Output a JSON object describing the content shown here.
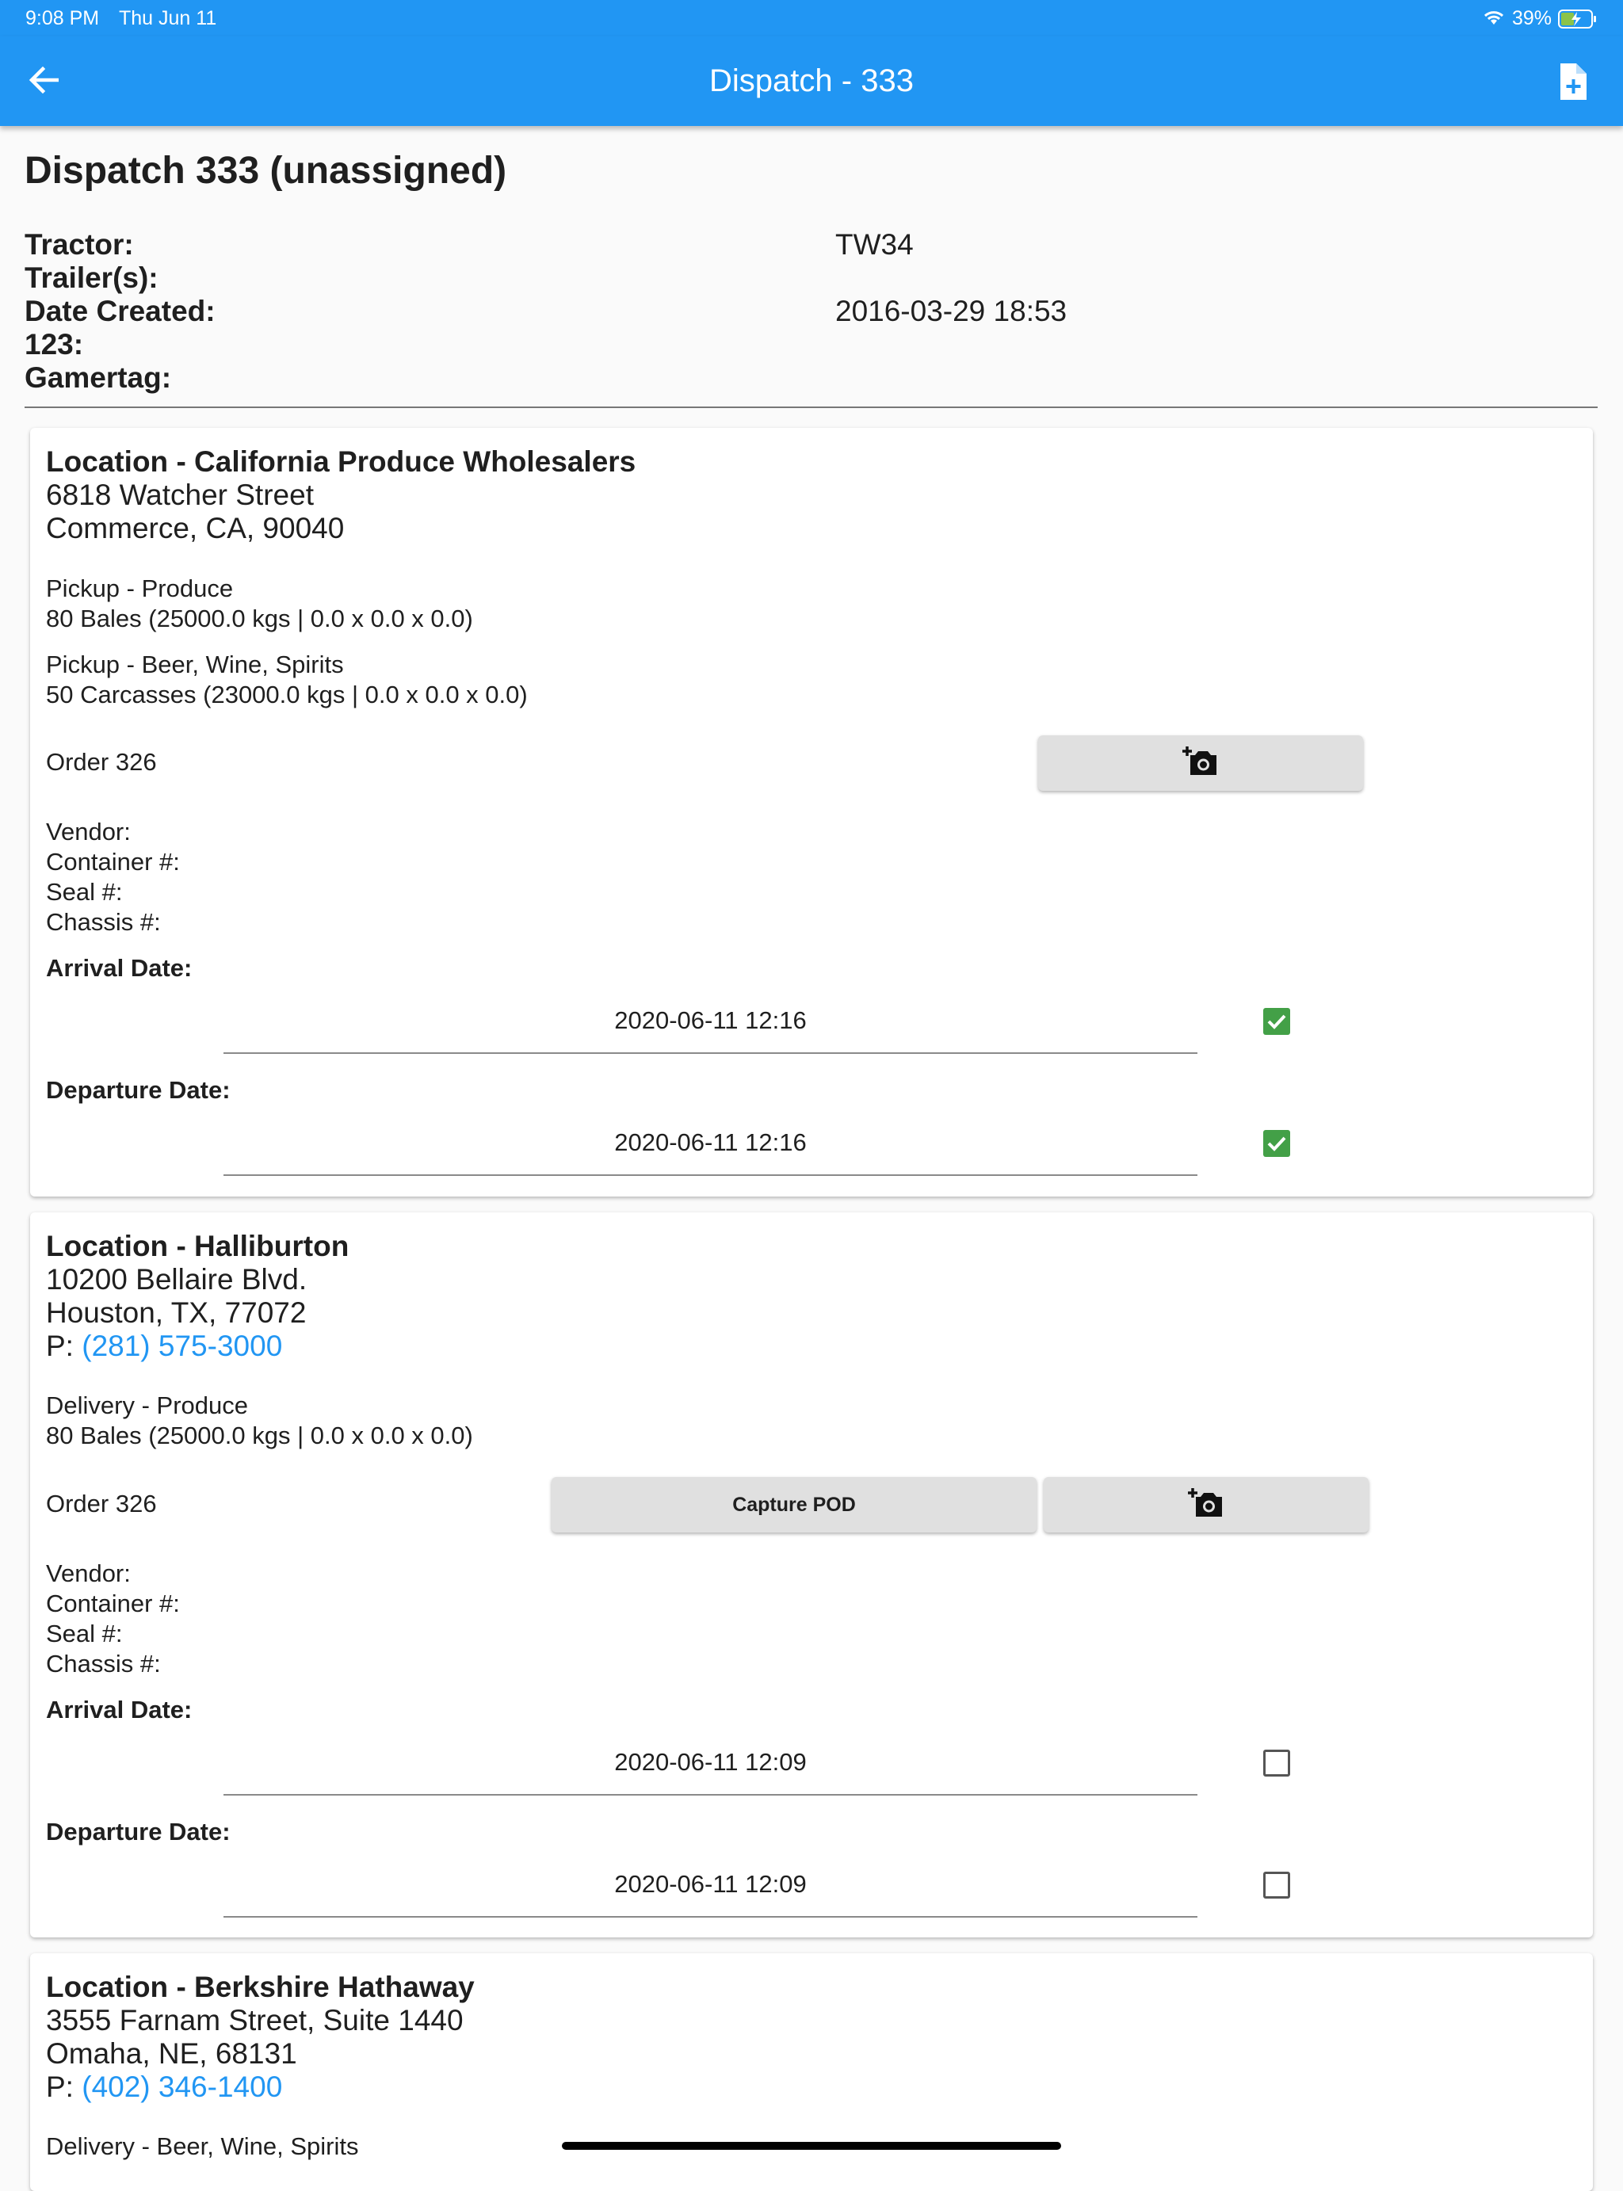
{
  "status": {
    "time": "9:08 PM",
    "date": "Thu Jun 11",
    "battery": "39%"
  },
  "appbar": {
    "title": "Dispatch - 333",
    "back_icon": "arrow-back-icon",
    "action_icon": "add-document-icon"
  },
  "dispatch": {
    "title": "Dispatch 333 (unassigned)",
    "labels": {
      "tractor": "Tractor:",
      "trailers": "Trailer(s):",
      "date_created": "Date Created:",
      "field_123": "123:",
      "gamertag": "Gamertag:"
    },
    "values": {
      "tractor": "TW34",
      "date_created": "2016-03-29 18:53"
    }
  },
  "stops": [
    {
      "title": "Location - California Produce Wholesalers",
      "address1": "6818 Watcher Street",
      "address2": "Commerce, CA, 90040",
      "items": [
        {
          "line1": "Pickup - Produce",
          "line2": "80 Bales (25000.0 kgs | 0.0 x 0.0 x 0.0)"
        },
        {
          "line1": "Pickup - Beer, Wine, Spirits",
          "line2": "50 Carcasses (23000.0 kgs | 0.0 x 0.0 x 0.0)"
        }
      ],
      "order": "Order 326",
      "vendor": "Vendor:",
      "container": "Container #:",
      "seal": "Seal #:",
      "chassis": "Chassis #:",
      "arrival_label": "Arrival Date:",
      "arrival": "2020-06-11 12:16",
      "arrival_checked": true,
      "departure_label": "Departure Date:",
      "departure": "2020-06-11 12:16",
      "departure_checked": true
    },
    {
      "title": "Location - Halliburton",
      "address1": "10200 Bellaire Blvd.",
      "address2": "Houston, TX, 77072",
      "phone_prefix": "P: ",
      "phone": "(281) 575-3000",
      "items": [
        {
          "line1": "Delivery - Produce",
          "line2": "80 Bales (25000.0 kgs | 0.0 x 0.0 x 0.0)"
        }
      ],
      "order": "Order 326",
      "pod_button": "Capture POD",
      "vendor": "Vendor:",
      "container": "Container #:",
      "seal": "Seal #:",
      "chassis": "Chassis #:",
      "arrival_label": "Arrival Date:",
      "arrival": "2020-06-11 12:09",
      "arrival_checked": false,
      "departure_label": "Departure Date:",
      "departure": "2020-06-11 12:09",
      "departure_checked": false
    },
    {
      "title": "Location - Berkshire Hathaway",
      "address1": "3555 Farnam Street, Suite 1440",
      "address2": "Omaha, NE, 68131",
      "phone_prefix": "P: ",
      "phone": "(402) 346-1400",
      "items": [
        {
          "line1": "Delivery - Beer, Wine, Spirits"
        }
      ]
    }
  ],
  "colors": {
    "primary": "#2196f3",
    "checkbox_on": "#43a047",
    "link": "#2196f3"
  }
}
